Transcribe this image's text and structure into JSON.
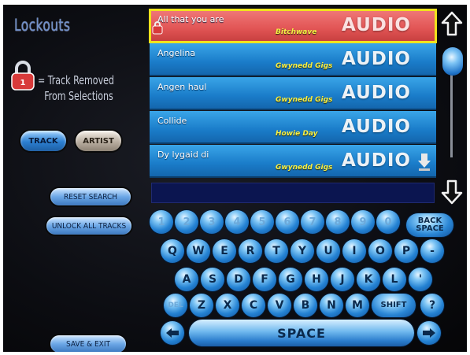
{
  "left": {
    "title": "Lockouts",
    "legend_line1": "= Track Removed",
    "legend_line2": "From Selections",
    "toggle_track": "TRACK",
    "toggle_artist": "ARTIST",
    "reset_search": "RESET SEARCH",
    "unlock_all": "UNLOCK ALL TRACKS",
    "save_exit": "SAVE & EXIT"
  },
  "list": {
    "rows": [
      {
        "song": "All that you are",
        "artist": "Bitchwave",
        "media": "AUDIO"
      },
      {
        "song": "Angelina",
        "artist": "Gwynedd Gigs",
        "media": "AUDIO"
      },
      {
        "song": "Angen haul",
        "artist": "Gwynedd Gigs",
        "media": "AUDIO"
      },
      {
        "song": "Collide",
        "artist": "Howie Day",
        "media": "AUDIO"
      },
      {
        "song": "Dy lygaid di",
        "artist": "Gwynedd Gigs",
        "media": "AUDIO"
      }
    ]
  },
  "keyboard": {
    "row1": [
      "1",
      "2",
      "3",
      "4",
      "5",
      "6",
      "7",
      "8",
      "9",
      "0"
    ],
    "backspace": "BACK SPACE",
    "row2": [
      "Q",
      "W",
      "E",
      "R",
      "T",
      "Y",
      "U",
      "I",
      "O",
      "P",
      "-"
    ],
    "row3": [
      "A",
      "S",
      "D",
      "F",
      "G",
      "H",
      "J",
      "K",
      "L",
      "'"
    ],
    "row4": [
      "DEL",
      "Z",
      "X",
      "C",
      "V",
      "B",
      "N",
      "M"
    ],
    "shift": "SHIFT",
    "question": "?",
    "space": "SPACE"
  },
  "colors": {
    "list_row": "#1a7cc9",
    "selected_row": "#e25555",
    "highlight": "#f1e31c",
    "artist_text": "#f7f046"
  }
}
